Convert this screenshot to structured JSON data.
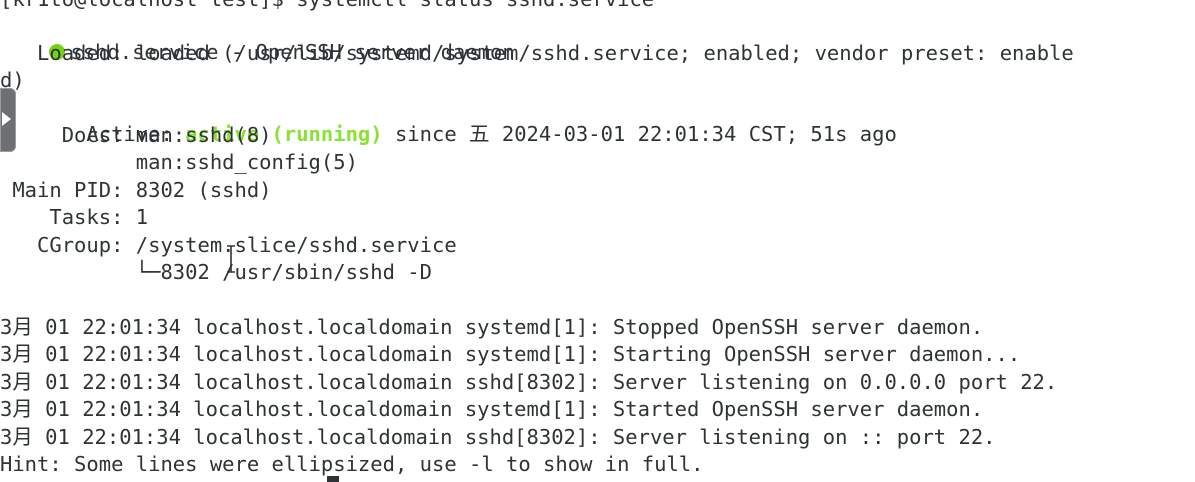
{
  "terminal": {
    "lines": [
      "[kr1to@localhost test]$ systemctl status sshd.service",
      "sshd.service - OpenSSH server daemon",
      "   Loaded: loaded (/usr/lib/systemd/system/sshd.service; enabled; vendor preset: enable",
      "d)",
      "   Active: ",
      "active (running)",
      " since 五 2024-03-01 22:01:34 CST; 51s ago",
      "     Docs: man:sshd(8)",
      "           man:sshd_config(5)",
      " Main PID: 8302 (sshd)",
      "    Tasks: 1",
      "   CGroup: /system.slice/sshd.service",
      "           └─8302 /usr/sbin/sshd -D",
      "3月 01 22:01:34 localhost.localdomain systemd[1]: Stopped OpenSSH server daemon.",
      "3月 01 22:01:34 localhost.localdomain systemd[1]: Starting OpenSSH server daemon...",
      "3月 01 22:01:34 localhost.localdomain sshd[8302]: Server listening on 0.0.0.0 port 22.",
      "3月 01 22:01:34 localhost.localdomain systemd[1]: Started OpenSSH server daemon.",
      "3月 01 22:01:34 localhost.localdomain sshd[8302]: Server listening on :: port 22.",
      "Hint: Some lines were ellipsized, use -l to show in full."
    ]
  },
  "colors": {
    "status_dot": "#73d216",
    "active_text": "#8ae234",
    "foreground": "#2e3436",
    "background": "#ffffff"
  },
  "icons": {
    "status": "green-dot-icon",
    "side_handle": "side-panel-handle-icon",
    "mouse_cursor": "text-ibeam-cursor-icon"
  }
}
